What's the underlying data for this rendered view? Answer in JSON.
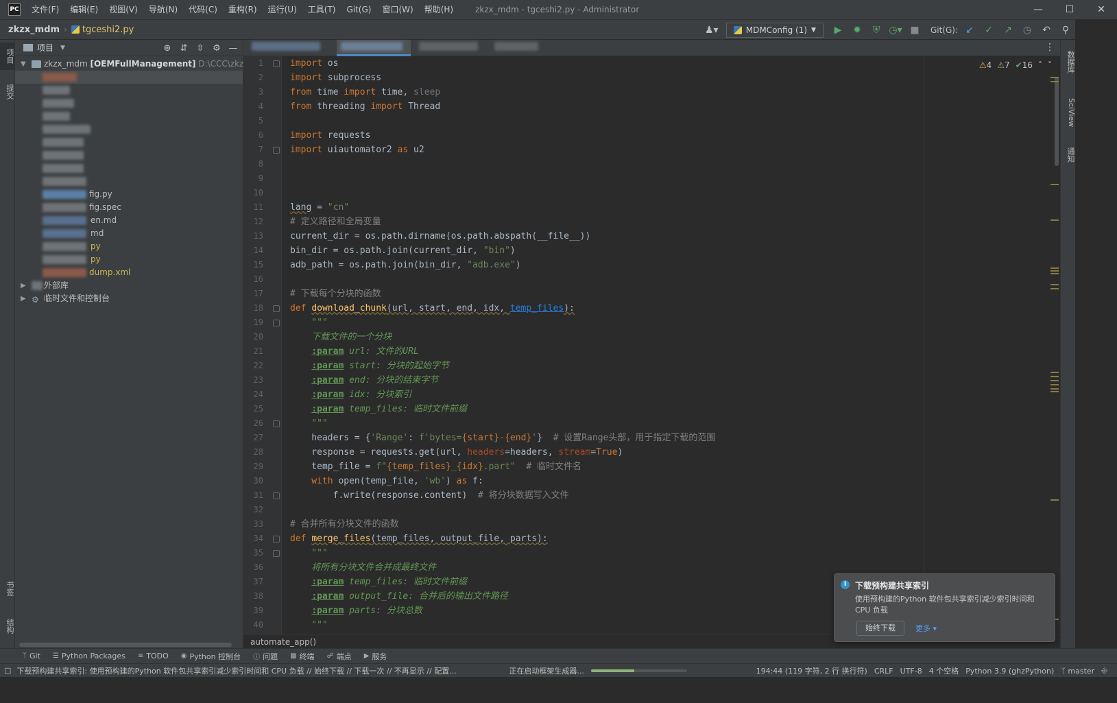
{
  "menu": {
    "logo": "PC",
    "items": [
      "文件(F)",
      "编辑(E)",
      "视图(V)",
      "导航(N)",
      "代码(C)",
      "重构(R)",
      "运行(U)",
      "工具(T)",
      "Git(G)",
      "窗口(W)",
      "帮助(H)"
    ],
    "window_title": "zkzx_mdm - tgceshi2.py - Administrator"
  },
  "navbar": {
    "project": "zkzx_mdm",
    "file": "tgceshi2.py",
    "run_config": "MDMConfig (1)",
    "git_label": "Git(G):"
  },
  "left_strip": {
    "project_tab": "项目",
    "commit_tab": "提交",
    "bookmarks_tab": "书签",
    "structure_tab": "结构"
  },
  "right_strip": {
    "db_tab": "数据库",
    "sciview_tab": "SciView",
    "notif_tab": "通知"
  },
  "project_panel": {
    "title": "项目",
    "root_name": "zkzx_mdm",
    "root_module": "[OEMFullManagement]",
    "root_path": "D:\\CCC\\zkzx_m",
    "files": [
      {
        "label": "fig.py",
        "color": "#bbbbbb"
      },
      {
        "label": "fig.spec",
        "color": "#bbbbbb"
      },
      {
        "label": "en.md",
        "color": "#bbbbbb"
      },
      {
        "label": "md",
        "color": "#bbbbbb"
      },
      {
        "label": "py",
        "color": "#c9b458"
      },
      {
        "label": "py",
        "color": "#c9b458"
      },
      {
        "label": "dump.xml",
        "color": "#c9b458"
      }
    ],
    "external_libs": "外部库",
    "scratches": "临时文件和控制台"
  },
  "editor": {
    "inspection": {
      "warnings": "4",
      "weak_warnings": "7",
      "ok": "16"
    },
    "bottom_breadcrumb": "automate_app()",
    "line_numbers": [
      "1",
      "2",
      "3",
      "4",
      "5",
      "6",
      "7",
      "8",
      "9",
      "10",
      "11",
      "12",
      "13",
      "14",
      "15",
      "16",
      "17",
      "18",
      "19",
      "20",
      "21",
      "22",
      "23",
      "24",
      "25",
      "26",
      "27",
      "28",
      "29",
      "30",
      "31",
      "32",
      "33",
      "34",
      "35",
      "36",
      "37",
      "38",
      "39",
      "40"
    ],
    "code": {
      "l1_kw": "import",
      "l1_mod": " os",
      "l2_kw": "import",
      "l2_mod": " subprocess",
      "l3_kw": "from",
      "l3_mod": " time ",
      "l3_kw2": "import",
      "l3_rest": " time, ",
      "l3_dim": "sleep",
      "l4_kw": "from",
      "l4_mod": " threading ",
      "l4_kw2": "import",
      "l4_rest": " Thread",
      "l6_kw": "import",
      "l6_mod": " requests",
      "l7_kw": "import",
      "l7_mod": " uiautomator2 ",
      "l7_kw2": "as",
      "l7_rest": " u2",
      "l11_var": "lang",
      "l11_eq": " = ",
      "l11_str": "\"cn\"",
      "l12_cm": "# 定义路径和全局变量",
      "l13": "current_dir = os.path.dirname(os.path.abspath(__file__))",
      "l14_a": "bin_dir = os.path.join(current_dir, ",
      "l14_str": "\"bin\"",
      "l14_b": ")",
      "l15_a": "adb_path = os.path.join(bin_dir, ",
      "l15_str": "\"adb.exe\"",
      "l15_b": ")",
      "l17_cm": "# 下载每个分块的函数",
      "l18_kw": "def",
      "l18_fn": "download_chunk",
      "l18_args": "(url, start, end, idx, ",
      "l18_link": "temp_files",
      "l18_end": "):",
      "l19_doc": "    \"\"\"",
      "l20_doc": "    下载文件的一个分块",
      "l21_tag": ":param",
      "l21_name": " url: ",
      "l21_doc": "文件的URL",
      "l22_tag": ":param",
      "l22_name": " start: ",
      "l22_doc": "分块的起始字节",
      "l23_tag": ":param",
      "l23_name": " end: ",
      "l23_doc": "分块的结束字节",
      "l24_tag": ":param",
      "l24_name": " idx: ",
      "l24_doc": "分块索引",
      "l25_tag": ":param",
      "l25_name": " temp_files: ",
      "l25_doc": "临时文件前缀",
      "l26_doc": "    \"\"\"",
      "l27_a": "    headers = {",
      "l27_s1": "'Range'",
      "l27_b": ": ",
      "l27_s2": "f'bytes=",
      "l27_c": "{start}",
      "l27_s3": "-",
      "l27_d": "{end}",
      "l27_s4": "'",
      "l27_e": "}  ",
      "l27_cm": "# 设置Range头部，用于指定下载的范围",
      "l28_a": "    response = requests.get(url, ",
      "l28_p1": "headers",
      "l28_b": "=headers, ",
      "l28_p2": "stream",
      "l28_c": "=",
      "l28_kw": "True",
      "l28_d": ")",
      "l29_a": "    temp_file = ",
      "l29_s1": "f\"",
      "l29_b": "{temp_files}",
      "l29_s2": "_",
      "l29_c": "{idx}",
      "l29_s3": ".part\"",
      "l29_d": "  ",
      "l29_cm": "# 临时文件名",
      "l30_kw": "    with",
      "l30_a": " open(temp_file, ",
      "l30_str": "'wb'",
      "l30_b": ") ",
      "l30_kw2": "as",
      "l30_c": " f:",
      "l31_a": "        f.write(response.content)  ",
      "l31_cm": "# 将分块数据写入文件",
      "l33_cm": "# 合并所有分块文件的函数",
      "l34_kw": "def",
      "l34_fn": "merge_files",
      "l34_args": "(temp_files, output_file, parts):",
      "l35_doc": "    \"\"\"",
      "l36_doc": "    将所有分块文件合并成最终文件",
      "l37_tag": ":param",
      "l37_name": " temp_files: ",
      "l37_doc": "临时文件前缀",
      "l38_tag": ":param",
      "l38_name": " output_file: ",
      "l38_doc": "合并后的输出文件路径",
      "l39_tag": ":param",
      "l39_name": " parts: ",
      "l39_doc": "分块总数",
      "l40_doc": "    \"\"\""
    }
  },
  "notification": {
    "title": "下载预构建共享索引",
    "body": "使用预构建的Python 软件包共享索引减少索引时间和 CPU 负载",
    "download": "始终下载",
    "more": "更多 ▾"
  },
  "toolwindows": [
    "Git",
    "Python Packages",
    "TODO",
    "Python 控制台",
    "问题",
    "终端",
    "端点",
    "服务"
  ],
  "statusbar": {
    "message": "下载预构建共享索引: 使用预构建的Python 软件包共享索引减少索引时间和 CPU 负载 // 始终下载 // 下载一次 // 不再显示 // 配置...",
    "progress_text": "正在启动框架生成器...",
    "progress": 0.45,
    "position": "194:44 (119 字符, 2 行 换行符)",
    "line_sep": "CRLF",
    "encoding": "UTF-8",
    "indent": "4 个空格",
    "interpreter": "Python 3.9 (ghzPython)",
    "branch": "master"
  },
  "colors": {
    "accent": "#4a88c7",
    "keyword": "#cc7832",
    "string": "#6a8759",
    "function": "#ffc66d"
  }
}
